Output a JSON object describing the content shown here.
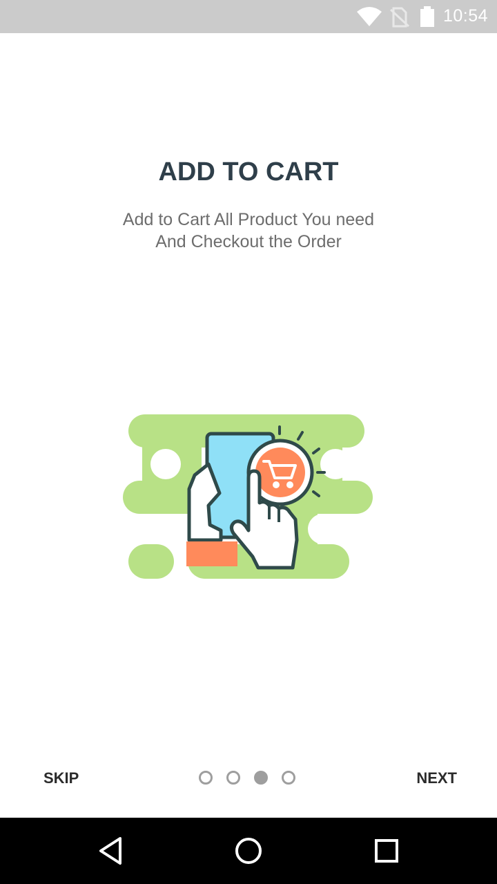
{
  "status_bar": {
    "time": "10:54",
    "icons": [
      "wifi-icon",
      "no-sim-icon",
      "battery-icon"
    ]
  },
  "onboarding": {
    "title": "ADD TO CART",
    "subtitle_line1": "Add to Cart All Product You need",
    "subtitle_line2": "And Checkout the Order",
    "illustration": "hand-tapping-phone-cart-icon",
    "current_page": 3,
    "total_pages": 4
  },
  "footer": {
    "skip_label": "SKIP",
    "next_label": "NEXT"
  },
  "navigation_bar": {
    "icons": [
      "back-icon",
      "home-icon",
      "recents-icon"
    ]
  },
  "colors": {
    "title": "#2f3f4a",
    "blob_green": "#b8e186",
    "phone_screen": "#8fe0f7",
    "accent_orange": "#ff8a5b",
    "outline": "#2f4a4a"
  }
}
